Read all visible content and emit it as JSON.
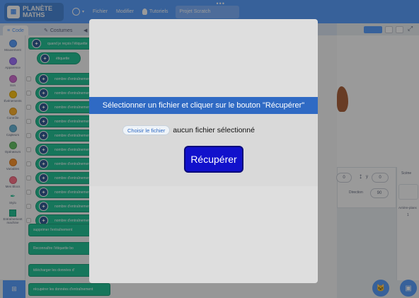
{
  "menubar": {
    "logo_line1": "PLANÈTE",
    "logo_line2": "MATHS",
    "file": "Fichier",
    "edit": "Modifier",
    "tutorials": "Tutoriels",
    "project_title": "Projet Scratch",
    "more_dots": "•••"
  },
  "tabs": {
    "code": "Code",
    "costumes": "Costumes"
  },
  "categories": [
    {
      "label": "Mouvement",
      "color": "#4c97ff"
    },
    {
      "label": "Apparence",
      "color": "#9966ff"
    },
    {
      "label": "Son",
      "color": "#cf63cf"
    },
    {
      "label": "Événements",
      "color": "#ffbf00"
    },
    {
      "label": "Contrôle",
      "color": "#ffab19"
    },
    {
      "label": "Capteurs",
      "color": "#5cb1d6"
    },
    {
      "label": "Opérateurs",
      "color": "#59c059"
    },
    {
      "label": "Variables",
      "color": "#ff8c1a"
    },
    {
      "label": "Mes Blocs",
      "color": "#ff6680"
    },
    {
      "label": "Stylo",
      "color": "#0fbd8c"
    },
    {
      "label": "Entraînement machine",
      "color": "#0fbd8c"
    }
  ],
  "blocks": [
    "quand je reçois l'étiquette",
    "étiquette",
    "nombre d'entraînement",
    "nombre d'entraînement",
    "nombre d'entraînement",
    "nombre d'entraînement",
    "nombre d'entraînement",
    "nombre d'entraînement",
    "nombre d'entraînement",
    "nombre d'entraînement",
    "nombre d'entraînement",
    "nombre d'entraînement",
    "nombre d'entraînement",
    "supprimer l'entraînement",
    "Reconnaître l'étiquette bo",
    "télécharger les données d'",
    "récupérer les données d'entraînement"
  ],
  "sprite_info": {
    "direction_label": "Direction",
    "direction_value": "90",
    "x_value": "0",
    "y_value": "0",
    "y_label": "y"
  },
  "stage_pane": {
    "title": "Scène",
    "backdrops_label": "Arrière-plans",
    "backdrops_count": "1"
  },
  "modal": {
    "header": "Sélectionner un fichier et cliquer sur le bouton \"Récupérer\"",
    "choose_file": "Choisir le fichier",
    "no_file": "aucun fichier sélectionné",
    "recover": "Récupérer"
  },
  "colors": {
    "menubar": "#4c97ff",
    "modal_header": "#2f6ac4",
    "recover_button": "#1111cc",
    "block_green": "#0fbd8c"
  }
}
